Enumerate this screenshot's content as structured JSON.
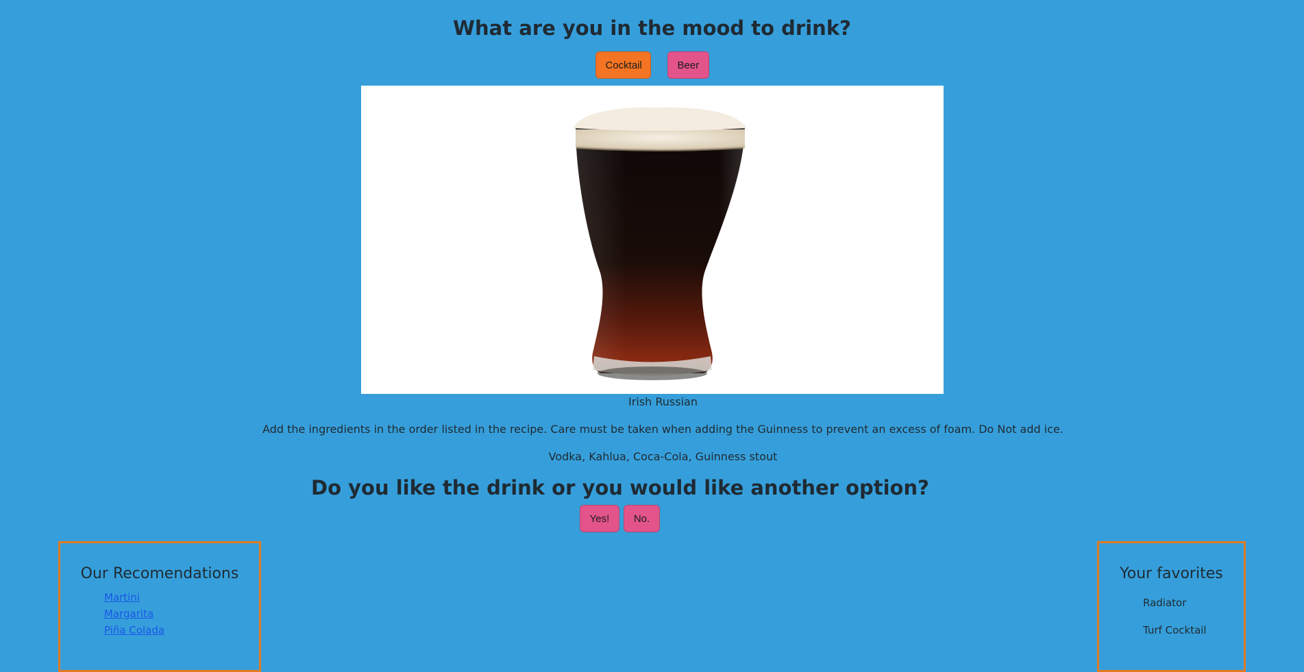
{
  "header": {
    "title": "What are you in the mood to drink?"
  },
  "mood_buttons": {
    "cocktail_label": "Cocktail",
    "beer_label": "Beer"
  },
  "drink": {
    "name": "Irish Russian",
    "instructions": "Add the ingredients in the order listed in the recipe. Care must be taken when adding the Guinness to prevent an excess of foam. Do Not add ice.",
    "ingredients": "Vodka, Kahlua, Coca-Cola, Guinness stout",
    "image_icon": "pint-glass-of-stout"
  },
  "feedback": {
    "question": "Do you like the drink or you would like another option?",
    "yes_label": "Yes!",
    "no_label": "No."
  },
  "recommendations": {
    "title": "Our Recomendations",
    "items": [
      {
        "label": "Martini"
      },
      {
        "label": "Margarita"
      },
      {
        "label": "Piña Colada"
      }
    ]
  },
  "favorites": {
    "title": "Your favorites",
    "items": [
      {
        "label": "Radiator"
      },
      {
        "label": "Turf Cocktail"
      }
    ]
  },
  "colors": {
    "background": "#369fdb",
    "cocktail_button": "#f47423",
    "pink_button": "#e2548a",
    "panel_border": "#e07b24",
    "link": "#1a57e6"
  }
}
